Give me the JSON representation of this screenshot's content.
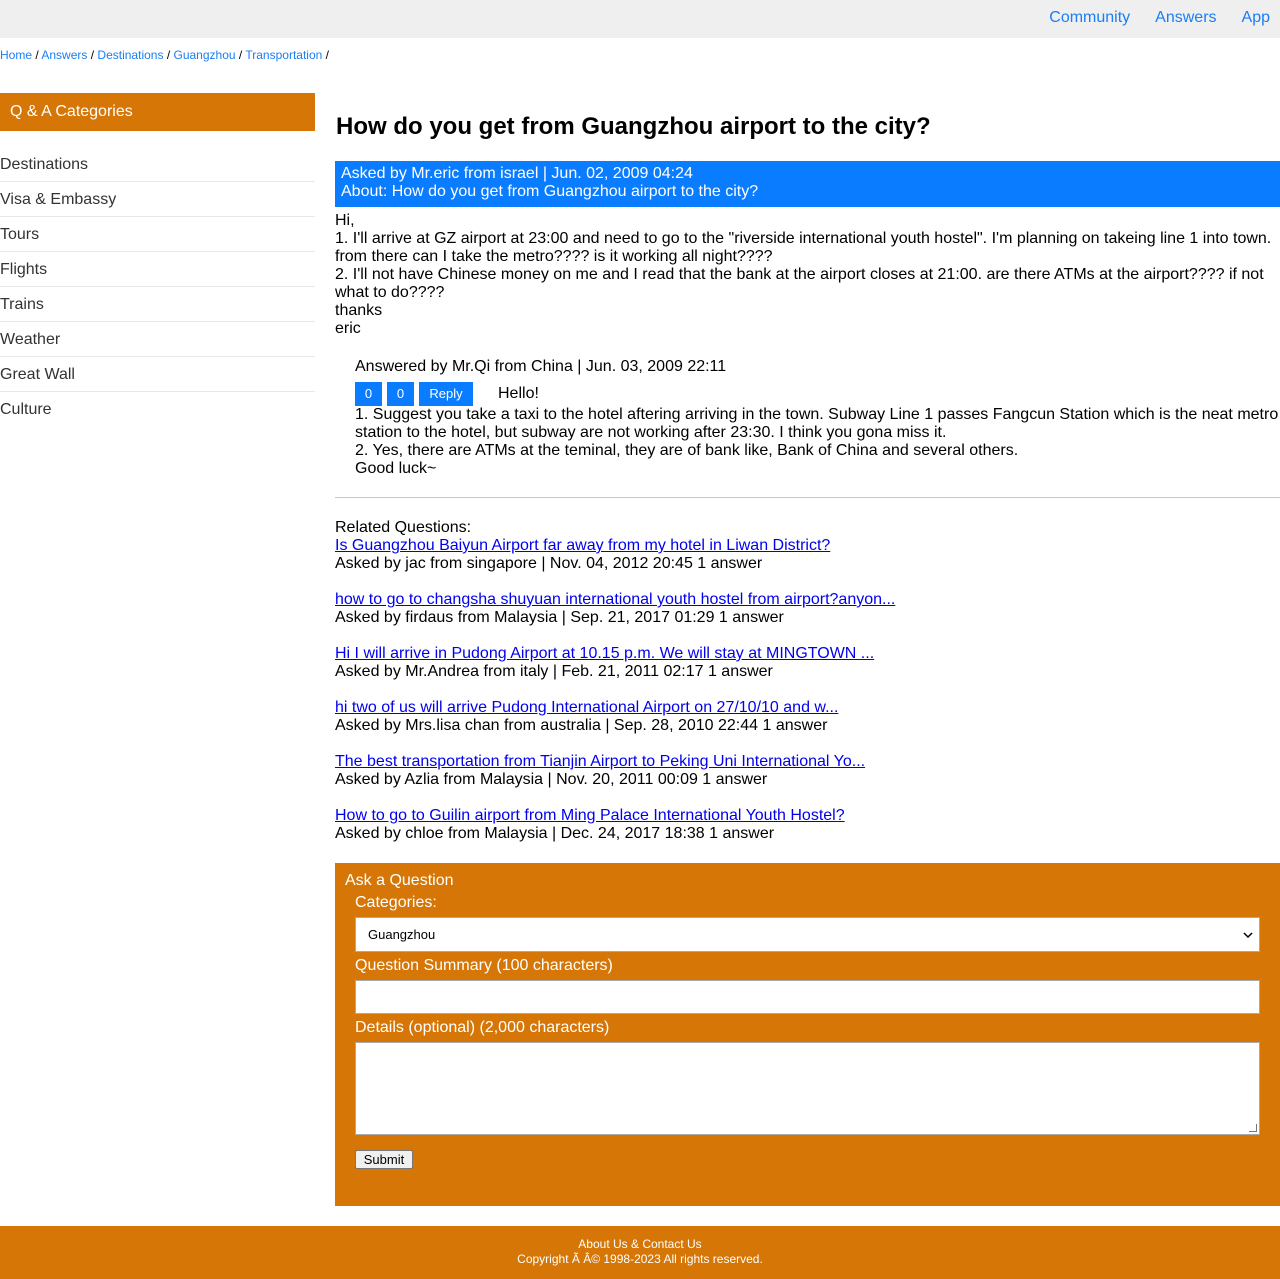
{
  "topnav": {
    "items": [
      "Community",
      "Answers",
      "App"
    ]
  },
  "breadcrumb": {
    "items": [
      "Home",
      "Answers",
      "Destinations",
      "Guangzhou",
      "Transportation"
    ],
    "separator": "/"
  },
  "sidebar": {
    "title": "Q & A Categories",
    "items": [
      "Destinations",
      "Visa & Embassy",
      "Tours",
      "Flights",
      "Trains",
      "Weather",
      "Great Wall",
      "Culture"
    ]
  },
  "question": {
    "title": "How do you get from Guangzhou airport to the city?",
    "asked_by": "Asked by Mr.eric from israel | Jun. 02, 2009 04:24",
    "about": "About: How do you get from Guangzhou airport to the city?",
    "body": [
      "Hi,",
      "1. I'll arrive at GZ airport at 23:00 and need to go to the \"riverside international youth hostel\". I'm planning on takeing line 1 into town. from there can I take the metro???? is it working all night????",
      "2. I'll not have Chinese money on me and I read that the bank at the airport closes at 21:00. are there ATMs at the airport???? if not what to do????",
      "thanks",
      "eric"
    ]
  },
  "answer": {
    "answered_by": "Answered by Mr.Qi from China | Jun. 03, 2009 22:11",
    "up_votes": "0",
    "down_votes": "0",
    "reply_label": "Reply",
    "first_line": "Hello!",
    "body": [
      "1. Suggest you take a taxi to the hotel aftering arriving in the town. Subway Line 1 passes Fangcun Station which is the neat metro station to the hotel, but subway are not working after 23:30. I think you gona miss it.",
      "2. Yes, there are ATMs at the teminal, they are of bank like, Bank of China and several others.",
      "Good luck~"
    ]
  },
  "related": {
    "heading": "Related Questions:",
    "items": [
      {
        "title": "Is Guangzhou Baiyun Airport far away from my hotel in Liwan District?",
        "meta": "Asked by jac from singapore | Nov. 04, 2012 20:45 1 answer"
      },
      {
        "title": "how to go to changsha shuyuan international youth hostel from airport?anyon...",
        "meta": "Asked by firdaus from Malaysia | Sep. 21, 2017 01:29 1 answer"
      },
      {
        "title": "Hi I will arrive in Pudong Airport at 10.15 p.m. We will stay at MINGTOWN ...",
        "meta": "Asked by Mr.Andrea from italy | Feb. 21, 2011 02:17 1 answer"
      },
      {
        "title": "hi two of us will arrive Pudong International Airport on 27/10/10 and w...",
        "meta": "Asked by Mrs.lisa chan from australia | Sep. 28, 2010 22:44 1 answer"
      },
      {
        "title": "The best transportation from Tianjin Airport to Peking Uni International Yo...",
        "meta": "Asked by Azlia from Malaysia | Nov. 20, 2011 00:09 1 answer"
      },
      {
        "title": "How to go to Guilin airport from Ming Palace International Youth Hostel?",
        "meta": "Asked by chloe from Malaysia | Dec. 24, 2017 18:38 1 answer"
      }
    ]
  },
  "ask": {
    "title": "Ask a Question",
    "categories_label": "Categories:",
    "category_selected": "Guangzhou",
    "summary_label": "Question Summary (100 characters)",
    "summary_value": "",
    "details_label": "Details (optional) (2,000 characters)",
    "details_value": "",
    "submit_label": "Submit"
  },
  "footer": {
    "links": "About Us & Contact Us",
    "copyright": "Copyright Ã   Â© 1998-2023 All rights reserved."
  },
  "colors": {
    "accent_orange": "#d57607",
    "accent_blue": "#0a7cff",
    "link_blue": "#1a7ef5"
  }
}
